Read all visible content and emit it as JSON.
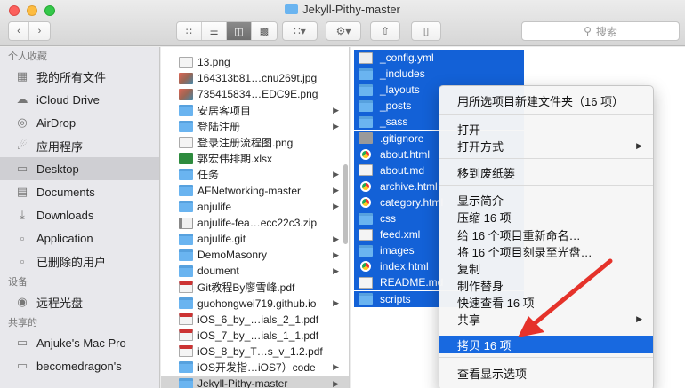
{
  "window": {
    "title": "Jekyll-Pithy-master"
  },
  "toolbar": {
    "back_icon": "chevron-left-icon",
    "forward_icon": "chevron-right-icon",
    "search_placeholder": "搜索"
  },
  "sidebar": {
    "favorites_header": "个人收藏",
    "favorites": [
      {
        "label": "我的所有文件",
        "icon": "all-files-icon"
      },
      {
        "label": "iCloud Drive",
        "icon": "cloud-icon"
      },
      {
        "label": "AirDrop",
        "icon": "airdrop-icon"
      },
      {
        "label": "应用程序",
        "icon": "applications-icon"
      },
      {
        "label": "Desktop",
        "icon": "desktop-icon"
      },
      {
        "label": "Documents",
        "icon": "documents-icon"
      },
      {
        "label": "Downloads",
        "icon": "downloads-icon"
      },
      {
        "label": "Application",
        "icon": "folder-icon"
      },
      {
        "label": "已删除的用户",
        "icon": "folder-icon"
      }
    ],
    "devices_header": "设备",
    "devices": [
      {
        "label": "远程光盘",
        "icon": "disc-icon"
      }
    ],
    "shared_header": "共享的",
    "shared": [
      {
        "label": "Anjuke's Mac Pro",
        "icon": "computer-icon"
      },
      {
        "label": "becomedragon's",
        "icon": "computer-icon"
      }
    ]
  },
  "column2": {
    "items": [
      {
        "label": "13.png",
        "type": "file"
      },
      {
        "label": "164313b81…cnu269t.jpg",
        "type": "img"
      },
      {
        "label": "735415834…EDC9E.png",
        "type": "img"
      },
      {
        "label": "安居客项目",
        "type": "folder"
      },
      {
        "label": "登陆注册",
        "type": "folder"
      },
      {
        "label": "登录注册流程图.png",
        "type": "file"
      },
      {
        "label": "郭宏伟排期.xlsx",
        "type": "xls"
      },
      {
        "label": "任务",
        "type": "folder"
      },
      {
        "label": "AFNetworking-master",
        "type": "folder"
      },
      {
        "label": "anjulife",
        "type": "folder"
      },
      {
        "label": "anjulife-fea…ecc22c3.zip",
        "type": "zip"
      },
      {
        "label": "anjulife.git",
        "type": "folder"
      },
      {
        "label": "DemoMasonry",
        "type": "folder"
      },
      {
        "label": "doument",
        "type": "folder"
      },
      {
        "label": "Git教程By廖雪峰.pdf",
        "type": "pdf"
      },
      {
        "label": "guohongwei719.github.io",
        "type": "folder"
      },
      {
        "label": "iOS_6_by_…ials_2_1.pdf",
        "type": "pdf"
      },
      {
        "label": "iOS_7_by_…ials_1_1.pdf",
        "type": "pdf"
      },
      {
        "label": "iOS_8_by_T…s_v_1.2.pdf",
        "type": "pdf"
      },
      {
        "label": "iOS开发指…iOS7）code",
        "type": "folder"
      },
      {
        "label": "Jekyll-Pithy-master",
        "type": "folder"
      }
    ]
  },
  "column3": {
    "items": [
      {
        "label": "_config.yml",
        "type": "yml"
      },
      {
        "label": "_includes",
        "type": "folder"
      },
      {
        "label": "_layouts",
        "type": "folder"
      },
      {
        "label": "_posts",
        "type": "folder"
      },
      {
        "label": "_sass",
        "type": "folder"
      },
      {
        "label": ".gitignore",
        "type": "gray"
      },
      {
        "label": "about.html",
        "type": "chrome"
      },
      {
        "label": "about.md",
        "type": "file"
      },
      {
        "label": "archive.html",
        "type": "chrome"
      },
      {
        "label": "category.html",
        "type": "chrome"
      },
      {
        "label": "css",
        "type": "folder"
      },
      {
        "label": "feed.xml",
        "type": "file"
      },
      {
        "label": "images",
        "type": "folder"
      },
      {
        "label": "index.html",
        "type": "chrome"
      },
      {
        "label": "README.md",
        "type": "file"
      },
      {
        "label": "scripts",
        "type": "folder"
      }
    ]
  },
  "context_menu": {
    "items": [
      {
        "label": "用所选项目新建文件夹（16 项）"
      },
      {
        "label": "打开"
      },
      {
        "label": "打开方式",
        "submenu": true
      },
      {
        "label": "移到废纸篓"
      },
      {
        "label": "显示简介"
      },
      {
        "label": "压缩 16 项"
      },
      {
        "label": "给 16 个项目重新命名…"
      },
      {
        "label": "将 16 个项目刻录至光盘…"
      },
      {
        "label": "复制"
      },
      {
        "label": "制作替身"
      },
      {
        "label": "快速查看 16 项"
      },
      {
        "label": "共享",
        "submenu": true
      },
      {
        "label": "拷贝 16 项",
        "highlighted": true
      },
      {
        "label": "查看显示选项"
      }
    ]
  },
  "colors": {
    "selection": "#1361d7",
    "menu_highlight": "#1869e0",
    "annotation": "#e5322a"
  }
}
